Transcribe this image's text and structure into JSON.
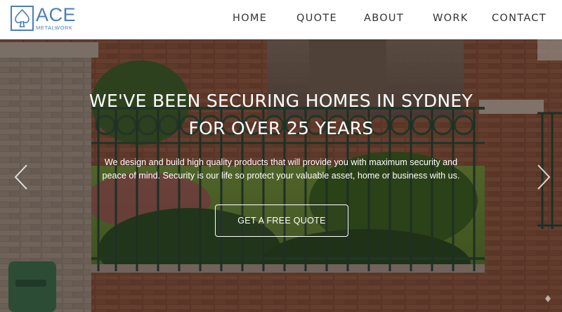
{
  "brand": {
    "name": "ACE",
    "sub": "METALWORK",
    "color": "#4a7fb8"
  },
  "nav": {
    "items": [
      {
        "label": "HOME"
      },
      {
        "label": "QUOTE"
      },
      {
        "label": "ABOUT"
      },
      {
        "label": "WORK"
      },
      {
        "label": "CONTACT"
      }
    ]
  },
  "hero": {
    "title_line1": "WE'VE BEEN SECURING HOMES IN SYDNEY",
    "title_line2": "FOR OVER 25 YEARS",
    "text": "We design and build high quality products that will provide you with maximum security and peace of mind. Security is our life so protect your valuable asset, home or business with us.",
    "cta_label": "GET A FREE QUOTE"
  },
  "icons": {
    "prev": "chevron-left-icon",
    "next": "chevron-right-icon",
    "logo": "spade-logo-icon"
  }
}
